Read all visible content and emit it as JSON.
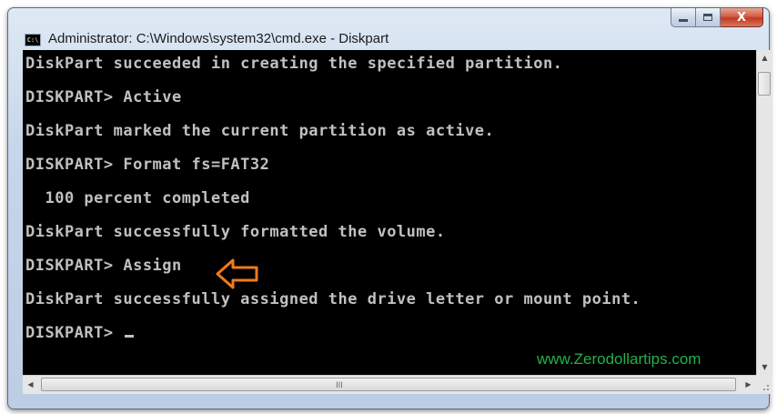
{
  "window": {
    "title": "Administrator: C:\\Windows\\system32\\cmd.exe - Diskpart",
    "app_icon": "cmd-icon",
    "app_icon_text": "C:\\",
    "buttons": {
      "minimize": "minimize-icon",
      "maximize": "maximize-icon",
      "close": "close-icon",
      "close_glyph": "X"
    }
  },
  "console": {
    "lines": [
      "DiskPart succeeded in creating the specified partition.",
      "DISKPART> Active",
      "DiskPart marked the current partition as active.",
      "DISKPART> Format fs=FAT32",
      "  100 percent completed",
      "DiskPart successfully formatted the volume.",
      "DISKPART> Assign",
      "DiskPart successfully assigned the drive letter or mount point.",
      "DISKPART> "
    ],
    "text_color": "#c0c0c0",
    "background": "#000000"
  },
  "watermark": {
    "text": "www.Zerodollartips.com",
    "color": "#22b04a"
  },
  "annotation": {
    "icon": "arrow-left-outline-icon",
    "color": "#f07a1a"
  },
  "scrollbars": {
    "vertical": {
      "up": "scroll-up-arrow-icon",
      "down": "scroll-down-arrow-icon"
    },
    "horizontal": {
      "left": "scroll-left-arrow-icon",
      "right": "scroll-right-arrow-icon",
      "grip": "III"
    }
  }
}
